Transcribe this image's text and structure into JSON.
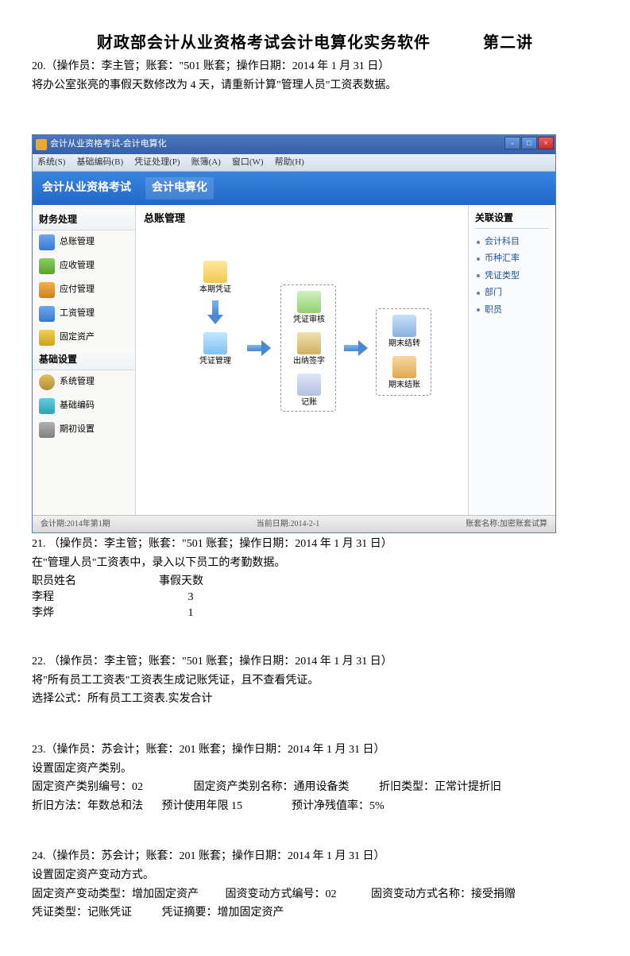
{
  "doc": {
    "title_main": "财政部会计从业资格考试会计电算化实务软件",
    "title_right": "第二讲",
    "q20_header": "20.（操作员：李主管；账套：\"501 账套；操作日期：2014 年 1 月 31 日）",
    "q20_body": "将办公室张亮的事假天数修改为 4 天，请重新计算\"管理人员\"工资表数据。",
    "q21_header": "21. （操作员：李主管；账套：\"501 账套；操作日期：2014 年 1 月 31 日）",
    "q21_body": "在\"管理人员\"工资表中，录入以下员工的考勤数据。",
    "q21_col1": "职员姓名",
    "q21_col2": "事假天数",
    "q21_r1c1": "李程",
    "q21_r1c2": "3",
    "q21_r2c1": "李烨",
    "q21_r2c2": "1",
    "q22_header": "22. （操作员：李主管；账套：\"501 账套；操作日期：2014 年 1 月 31 日）",
    "q22_body1": "将\"所有员工工资表\"工资表生成记账凭证，且不查看凭证。",
    "q22_body2": "选择公式：所有员工工资表.实发合计",
    "q23_header": "23.（操作员：苏会计；账套：201 账套；操作日期：2014 年 1 月 31 日）",
    "q23_body1": "设置固定资产类别。",
    "q23_body2a": "固定资产类别编号：02",
    "q23_body2b": "固定资产类别名称：通用设备类",
    "q23_body2c": "折旧类型：正常计提折旧",
    "q23_body3a": "折旧方法：年数总和法",
    "q23_body3b": "预计使用年限 15",
    "q23_body3c": "预计净残值率：5%",
    "q24_header": "24.（操作员：苏会计；账套：201 账套；操作日期：2014 年 1 月 31 日）",
    "q24_body1": "设置固定资产变动方式。",
    "q24_body2a": "固定资产变动类型：增加固定资产",
    "q24_body2b": "固资变动方式编号：02",
    "q24_body2c": "固资变动方式名称：接受捐赠",
    "q24_body3a": "凭证类型：记账凭证",
    "q24_body3b": "凭证摘要：增加固定资产"
  },
  "app": {
    "title": "会计从业资格考试-会计电算化",
    "menu": {
      "m1": "系统(S)",
      "m2": "基础编码(B)",
      "m3": "凭证处理(P)",
      "m4": "账簿(A)",
      "m5": "窗口(W)",
      "m6": "帮助(H)"
    },
    "banner": {
      "tab1": "会计从业资格考试",
      "tab2": "会计电算化"
    },
    "sidebar_left": {
      "sec1": "财务处理",
      "i1": "总账管理",
      "i2": "应收管理",
      "i3": "应付管理",
      "i4": "工资管理",
      "i5": "固定资产",
      "sec2": "基础设置",
      "i6": "系统管理",
      "i7": "基础编码",
      "i8": "期初设置"
    },
    "main": {
      "title": "总账管理",
      "f1": "本期凭证",
      "f2": "凭证管理",
      "f3": "凭证审核",
      "f4": "出纳签字",
      "f5": "记账",
      "f6": "期末结转",
      "f7": "期末结账"
    },
    "sidebar_right": {
      "title": "关联设置",
      "r1": "会计科目",
      "r2": "币种汇率",
      "r3": "凭证类型",
      "r4": "部门",
      "r5": "职员"
    },
    "status": {
      "left": "会计期:2014年第1期",
      "mid": "当前日期:2014-2-1",
      "right": "账套名称:加密账套试算"
    }
  }
}
